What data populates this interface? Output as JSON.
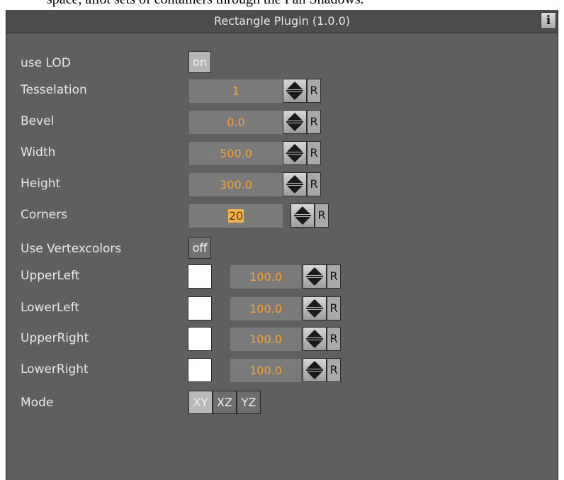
{
  "header": {
    "title": "Rectangle Plugin (1.0.0)",
    "info_label": "i"
  },
  "reset_label": "R",
  "use_lod": {
    "label": "use LOD",
    "value": "on"
  },
  "tesselation": {
    "label": "Tesselation",
    "value": "1"
  },
  "bevel": {
    "label": "Bevel",
    "value": "0.0"
  },
  "width": {
    "label": "Width",
    "value": "500.0"
  },
  "height": {
    "label": "Height",
    "value": "300.0"
  },
  "corners": {
    "label": "Corners",
    "value": "20"
  },
  "use_vertexcolors": {
    "label": "Use Vertexcolors",
    "value": "off"
  },
  "upper_left": {
    "label": "UpperLeft",
    "color": "#ffffff",
    "value": "100.0"
  },
  "lower_left": {
    "label": "LowerLeft",
    "color": "#ffffff",
    "value": "100.0"
  },
  "upper_right": {
    "label": "UpperRight",
    "color": "#ffffff",
    "value": "100.0"
  },
  "lower_right": {
    "label": "LowerRight",
    "color": "#ffffff",
    "value": "100.0"
  },
  "mode": {
    "label": "Mode",
    "options": [
      "XY",
      "XZ",
      "YZ"
    ],
    "selected": "XY"
  }
}
